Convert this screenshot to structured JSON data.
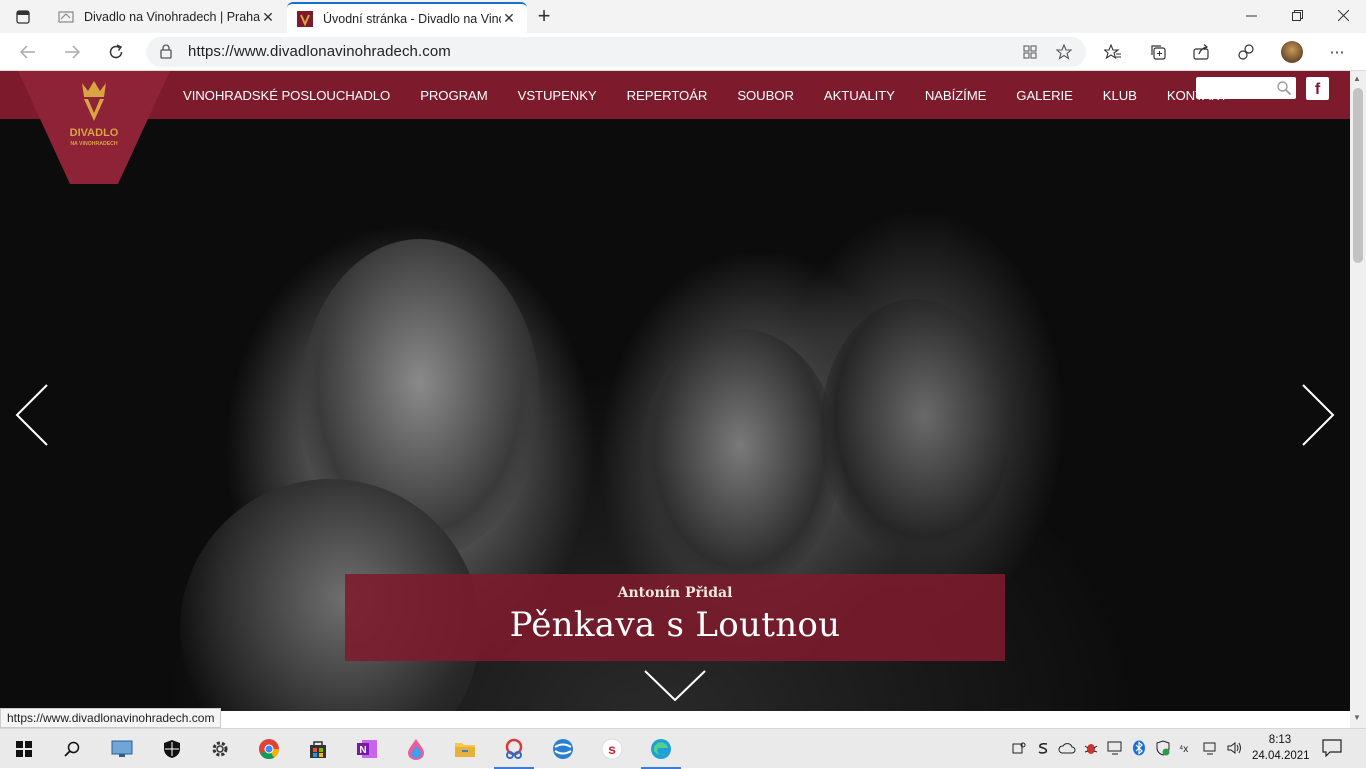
{
  "browser": {
    "tabs": [
      {
        "title": "Divadlo na Vinohradech | Praha-",
        "active": false
      },
      {
        "title": "Úvodní stránka - Divadlo na Vinc",
        "active": true
      }
    ],
    "new_tab_symbol": "+",
    "url": "https://www.divadlonavinohradech.com",
    "status_url": "https://www.divadlonavinohradech.com"
  },
  "site": {
    "logo_line1": "DIVADLO",
    "logo_line2": "NA VINOHRADECH",
    "menu": [
      "VINOHRADSKÉ POSLOUCHADLO",
      "PROGRAM",
      "VSTUPENKY",
      "REPERTOÁR",
      "SOUBOR",
      "AKTUALITY",
      "NABÍZÍME",
      "GALERIE",
      "KLUB",
      "KONTAKT"
    ],
    "search_placeholder": "",
    "facebook_label": "f",
    "slide": {
      "author": "Antonín Přidal",
      "title": "Pěnkava s Loutnou"
    }
  },
  "taskbar": {
    "time": "8:13",
    "date": "24.04.2021"
  },
  "colors": {
    "brand": "#7d1a2c",
    "gold": "#d9a441",
    "accent": "#1a6fd6"
  }
}
